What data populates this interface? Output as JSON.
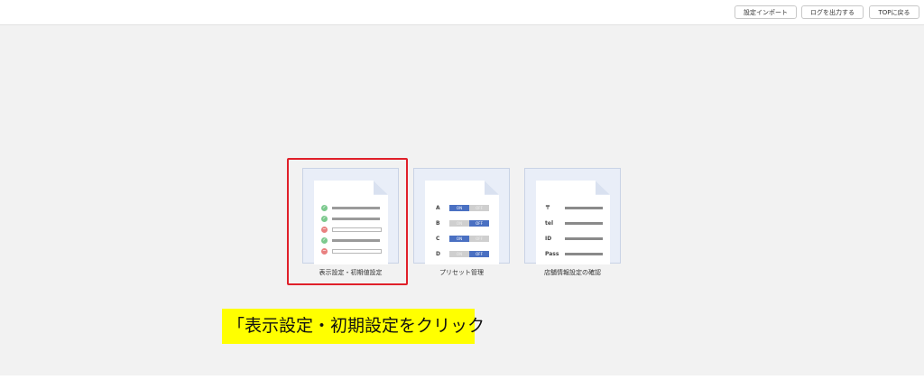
{
  "header": {
    "buttons": {
      "import": "設定インポート",
      "log": "ログを出力する",
      "top": "TOPに戻る"
    }
  },
  "cards": {
    "display": {
      "label": "表示設定・初期値設定",
      "rows": [
        {
          "status": "ok",
          "icon": "check-icon",
          "glyph": "✓"
        },
        {
          "status": "ok",
          "icon": "check-icon",
          "glyph": "✓"
        },
        {
          "status": "ng",
          "icon": "minus-icon",
          "glyph": "−"
        },
        {
          "status": "ok",
          "icon": "check-icon",
          "glyph": "✓"
        },
        {
          "status": "ng",
          "icon": "minus-icon",
          "glyph": "−"
        }
      ]
    },
    "preset": {
      "label": "プリセット管理",
      "rows": [
        {
          "letter": "A",
          "on": "ON",
          "off": "OFF",
          "state": "on"
        },
        {
          "letter": "B",
          "on": "ON",
          "off": "OFF",
          "state": "off"
        },
        {
          "letter": "C",
          "on": "ON",
          "off": "OFF",
          "state": "on"
        },
        {
          "letter": "D",
          "on": "ON",
          "off": "OFF",
          "state": "off"
        }
      ]
    },
    "store": {
      "label": "店舗情報設定の確認",
      "rows": [
        {
          "label": "〒"
        },
        {
          "label": "tel"
        },
        {
          "label": "ID"
        },
        {
          "label": "Pass"
        }
      ]
    }
  },
  "callout": {
    "text": "「表示設定・初期設定をクリック"
  },
  "colors": {
    "highlight": "#e0202a",
    "callout_bg": "#ffff00",
    "toggle_on": "#4a70c2",
    "toggle_off": "#cfcfcf"
  }
}
